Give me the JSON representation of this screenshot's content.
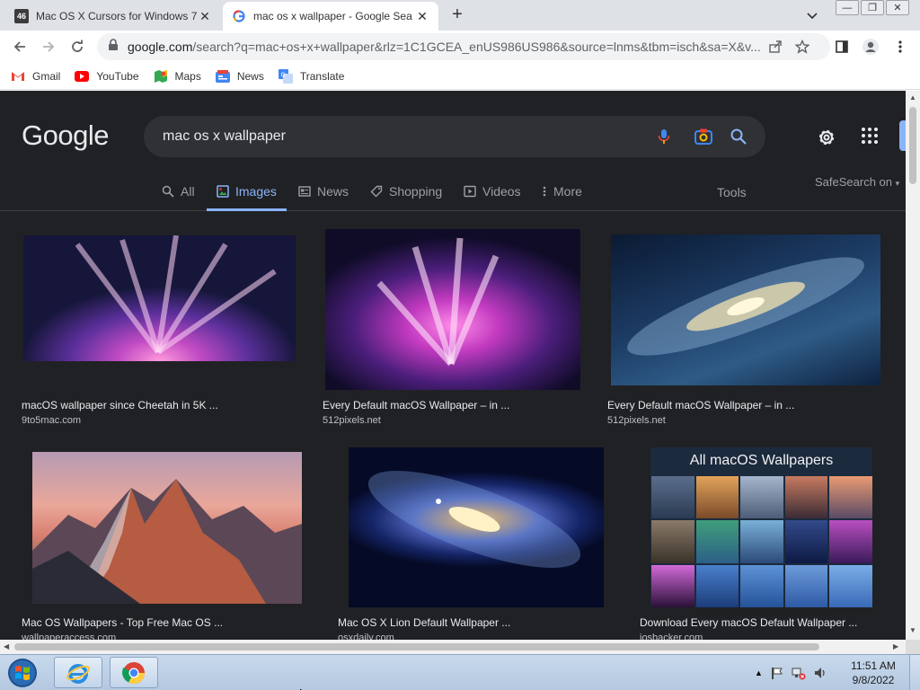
{
  "browser": {
    "tabs": [
      {
        "title": "Mac OS X Cursors for Windows 7",
        "badge": "46",
        "active": false
      },
      {
        "title": "mac os x wallpaper - Google Sea",
        "active": true
      }
    ],
    "new_tab_label": "+",
    "url_host": "google.com",
    "url_path": "/search?q=mac+os+x+wallpaper&rlz=1C1GCEA_enUS986US986&source=lnms&tbm=isch&sa=X&v...",
    "bookmarks": [
      {
        "label": "Gmail",
        "icon": "gmail-icon"
      },
      {
        "label": "YouTube",
        "icon": "youtube-icon"
      },
      {
        "label": "Maps",
        "icon": "maps-icon"
      },
      {
        "label": "News",
        "icon": "news-icon"
      },
      {
        "label": "Translate",
        "icon": "translate-icon"
      }
    ]
  },
  "google": {
    "logo": "Google",
    "query": "mac os x wallpaper",
    "tabs": [
      {
        "label": "All",
        "icon": "search-icon"
      },
      {
        "label": "Images",
        "icon": "image-icon",
        "active": true
      },
      {
        "label": "News",
        "icon": "news-icon"
      },
      {
        "label": "Shopping",
        "icon": "tag-icon"
      },
      {
        "label": "Videos",
        "icon": "video-icon"
      },
      {
        "label": "More",
        "icon": "more-vert-icon"
      }
    ],
    "tools_label": "Tools",
    "safesearch_label": "SafeSearch on",
    "results": [
      {
        "title": "macOS wallpaper since Cheetah in 5K ...",
        "site": "9to5mac.com"
      },
      {
        "title": "Every Default macOS Wallpaper – in ...",
        "site": "512pixels.net"
      },
      {
        "title": "Every Default macOS Wallpaper – in ...",
        "site": "512pixels.net"
      },
      {
        "title": "Mac OS Wallpapers - Top Free Mac OS ...",
        "site": "wallpaperaccess.com"
      },
      {
        "title": "Mac OS X Lion Default Wallpaper ...",
        "site": "osxdaily.com"
      },
      {
        "title": "Download Every macOS Default Wallpaper ...",
        "site": "iosbacker.com"
      }
    ],
    "collage_heading": "All macOS Wallpapers"
  },
  "taskbar": {
    "time": "11:51 AM",
    "date": "9/8/2022"
  },
  "colors": {
    "page_bg": "#202124",
    "accent": "#8ab4f8",
    "text": "#e8eaed"
  }
}
